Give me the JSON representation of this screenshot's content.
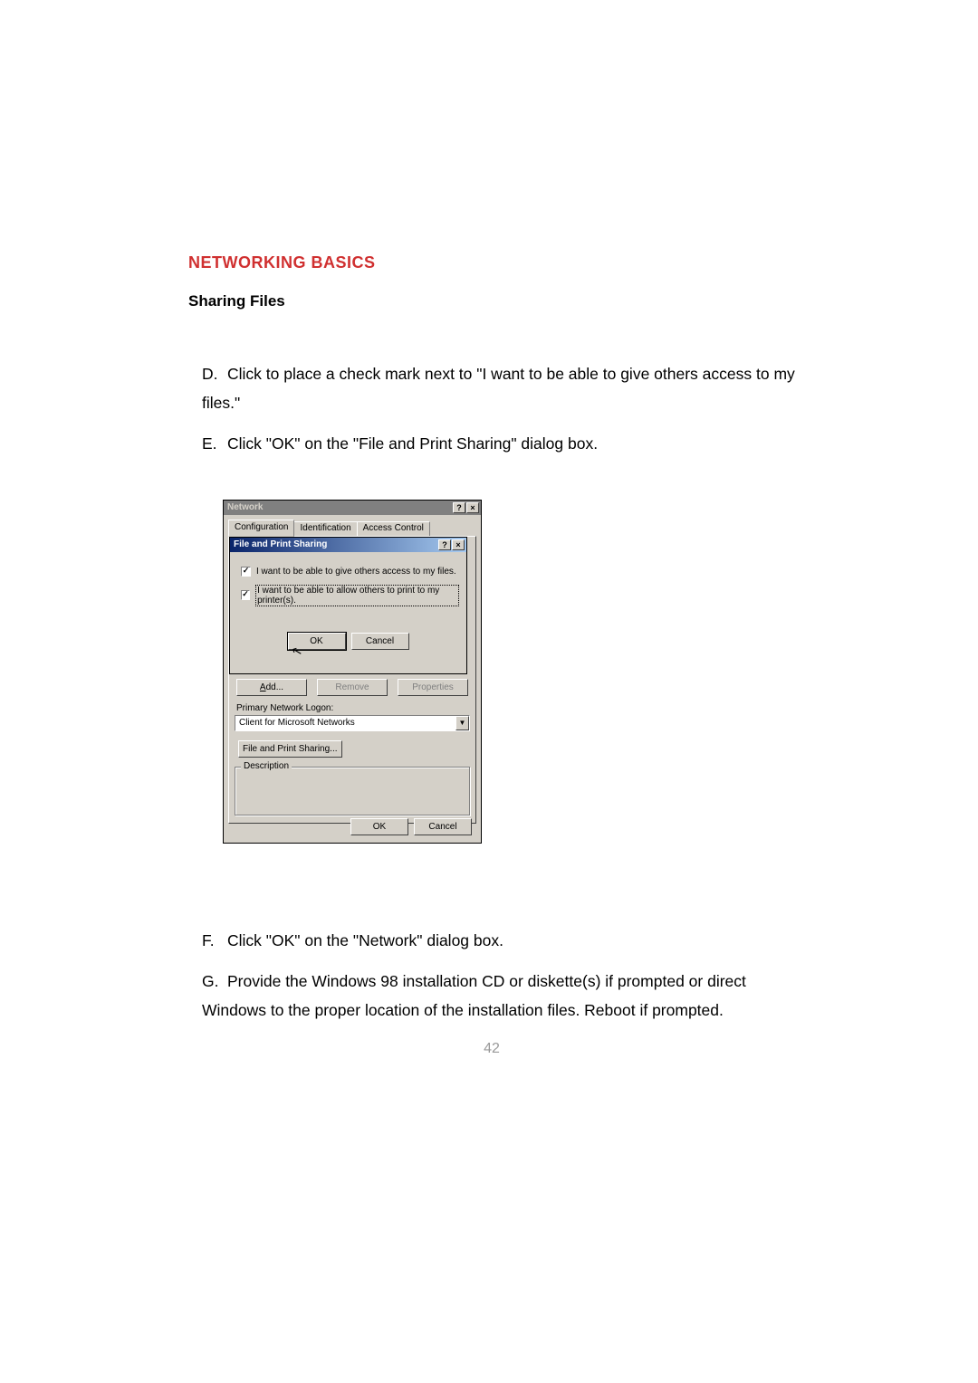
{
  "doc": {
    "section_header": "NETWORKING BASICS",
    "subtitle": "Sharing Files",
    "step_d_marker": "D.",
    "step_d": "Click to place a check mark next to \"I want to be able to give others access to my files.\"",
    "step_e_marker": "E.",
    "step_e": "Click \"OK\" on the \"File and Print Sharing\" dialog box.",
    "step_f_marker": "F.",
    "step_f": "Click \"OK\" on the \"Network\" dialog box.",
    "step_g_marker": "G.",
    "step_g": "Provide the Windows 98 installation CD or diskette(s) if prompted or direct Windows to the proper location of the installation files.  Reboot if prompted.",
    "page_number": "42"
  },
  "network_dialog": {
    "title": "Network",
    "help_glyph": "?",
    "close_glyph": "×",
    "tabs": [
      "Configuration",
      "Identification",
      "Access Control"
    ],
    "buttons": {
      "add": "Add...",
      "remove": "Remove",
      "properties": "Properties"
    },
    "primary_logon_label": "Primary Network Logon:",
    "primary_logon_value": "Client for Microsoft Networks",
    "fps_button": "File and Print Sharing...",
    "description_legend": "Description",
    "ok": "OK",
    "cancel": "Cancel"
  },
  "fps_dialog": {
    "title": "File and Print Sharing",
    "help_glyph": "?",
    "close_glyph": "×",
    "option_files": "I want to be able to give others access to my files.",
    "option_printers": "I want to be able to allow others to print to my printer(s).",
    "ok": "OK",
    "cancel": "Cancel"
  }
}
